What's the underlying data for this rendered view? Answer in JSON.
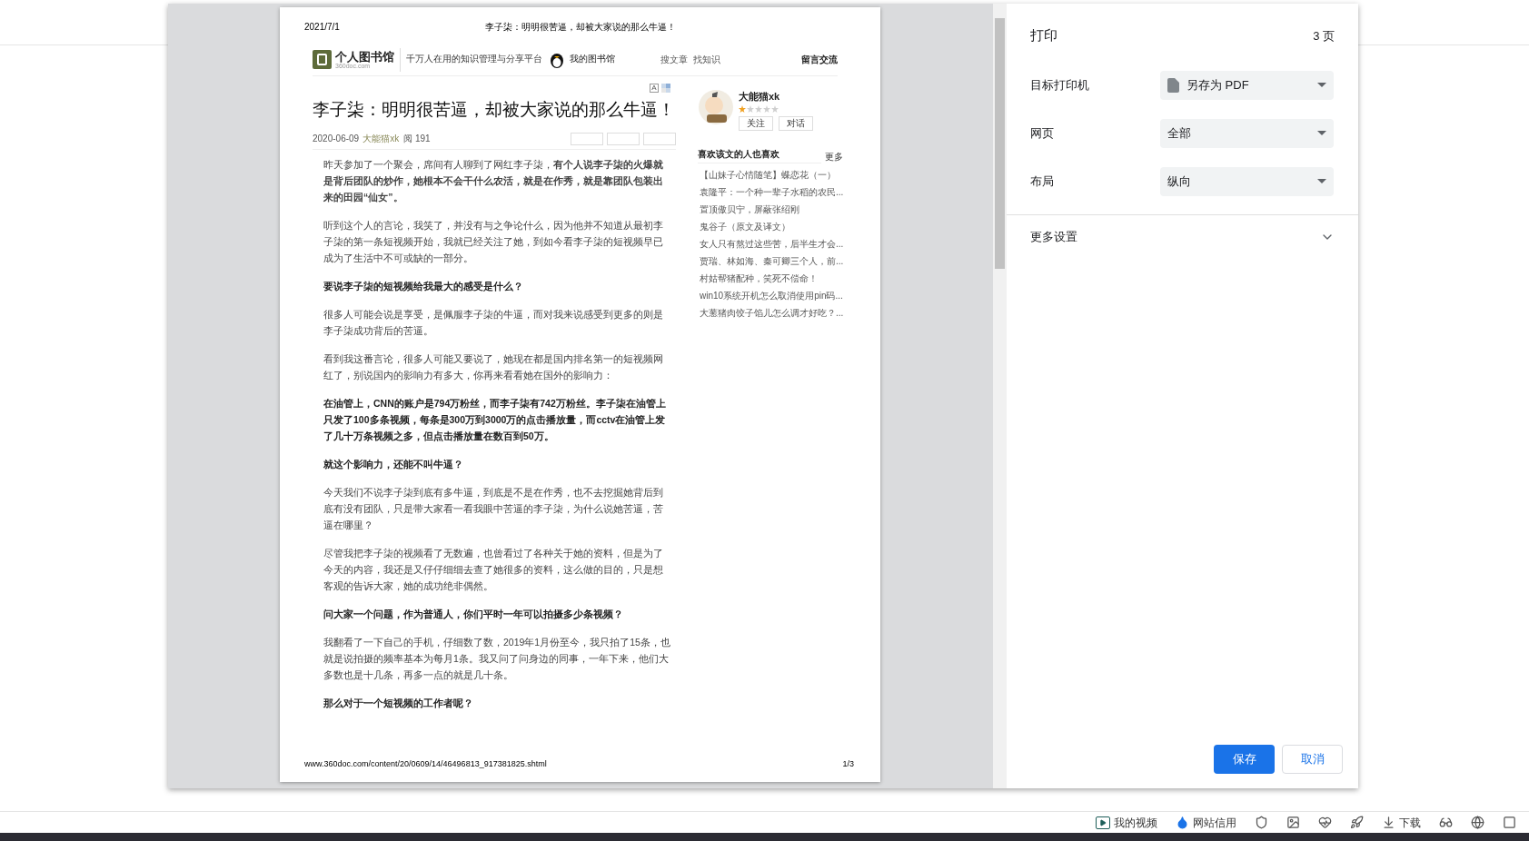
{
  "print_preview": {
    "page_header": {
      "date": "2021/7/1",
      "title": "李子柒：明明很苦逼，却被大家说的那么牛逼！"
    },
    "site_header": {
      "logo_text": "个人图书馆",
      "logo_domain": "360doc.com",
      "tagline": "千万人在用的知识管理与分享平台",
      "my_library": "我的图书馆",
      "links": [
        "搜文章",
        "找知识"
      ],
      "message": "留言交流"
    },
    "font_toggle": "A",
    "article": {
      "title": "李子柒：明明很苦逼，却被大家说的那么牛逼！",
      "date": "2020-06-09",
      "author": "大能猫xk",
      "reads": "阅 191",
      "paragraphs": [
        {
          "kind": "normal",
          "text": "昨天参加了一个聚会，席间有人聊到了网红李子柒，**有个人说李子柒的火爆就是背后团队的炒作，她根本不会干什么农活，就是在作秀，就是靠团队包装出来的田园“仙女”。**"
        },
        {
          "kind": "normal",
          "text": "听到这个人的言论，我笑了，并没有与之争论什么，因为他并不知道从最初李子柒的第一条短视频开始，我就已经关注了她，到如今看李子柒的短视频早已成为了生活中不可或缺的一部分。"
        },
        {
          "kind": "bold",
          "text": "要说李子柒的短视频给我最大的感受是什么？"
        },
        {
          "kind": "normal",
          "text": "很多人可能会说是享受，是佩服李子柒的牛逼，而对我来说感受到更多的则是李子柒成功背后的苦逼。"
        },
        {
          "kind": "normal",
          "text": "看到我这番言论，很多人可能又要说了，她现在都是国内排名第一的短视频网红了，别说国内的影响力有多大，你再来看看她在国外的影响力："
        },
        {
          "kind": "bold",
          "text": "在油管上，CNN的账户是794万粉丝，而李子柒有742万粉丝。李子柒在油管上只发了100多条视频，每条是300万到3000万的点击播放量，而cctv在油管上发了几十万条视频之多，但点击播放量在数百到50万。"
        },
        {
          "kind": "bold",
          "text": "就这个影响力，还能不叫牛逼？"
        },
        {
          "kind": "normal",
          "text": "今天我们不说李子柒到底有多牛逼，到底是不是在作秀，也不去挖掘她背后到底有没有团队，只是带大家看一看我眼中苦逼的李子柒，为什么说她苦逼，苦逼在哪里？"
        },
        {
          "kind": "normal",
          "text": "尽管我把李子柒的视频看了无数遍，也曾看过了各种关于她的资料，但是为了今天的内容，我还是又仔仔细细去查了她很多的资料，这么做的目的，只是想客观的告诉大家，她的成功绝非偶然。"
        },
        {
          "kind": "bold",
          "text": "问大家一个问题，作为普通人，你们平时一年可以拍摄多少条视频？"
        },
        {
          "kind": "normal",
          "text": "我翻看了一下自己的手机，仔细数了数，2019年1月份至今，我只拍了15条，也就是说拍摄的频率基本为每月1条。我又问了问身边的同事，一年下来，他们大多数也是十几条，再多一点的就是几十条。"
        },
        {
          "kind": "bold",
          "text": "那么对于一个短视频的工作者呢？"
        }
      ]
    },
    "sidebar": {
      "author_name": "大能猫xk",
      "stars": 1,
      "buttons": [
        "关注",
        "对话"
      ],
      "related_title": "喜欢该文的人也喜欢",
      "more": "更多",
      "related": [
        "【山妹子心情随笔】蝶恋花（一）",
        "袁隆平：一个种一辈子水稻的农民...",
        "置顶傲贝宁，屏蔽张绍刚",
        "鬼谷子（原文及译文）",
        "女人只有熬过这些苦，后半生才会...",
        "贾瑞、林如海、秦可卿三个人，前...",
        "村姑帮猪配种，笑死不偿命！",
        "win10系统开机怎么取消使用pin码...",
        "大葱猪肉饺子馅儿怎么调才好吃？..."
      ]
    },
    "page_footer": {
      "url": "www.360doc.com/content/20/0609/14/46496813_917381825.shtml",
      "page": "1/3"
    }
  },
  "print_panel": {
    "title": "打印",
    "page_count": "3 页",
    "settings": [
      {
        "label": "目标打印机",
        "value": "另存为 PDF",
        "kind": "destination"
      },
      {
        "label": "网页",
        "value": "全部",
        "kind": "plain"
      },
      {
        "label": "布局",
        "value": "纵向",
        "kind": "plain"
      }
    ],
    "more_settings": "更多设置",
    "expanded": false,
    "buttons": [
      {
        "label": "保存",
        "kind": "primary"
      },
      {
        "label": "取消",
        "kind": "secondary"
      }
    ]
  },
  "status_bar": {
    "video": "我的视频",
    "credit": "网站信用",
    "download": "下载"
  }
}
